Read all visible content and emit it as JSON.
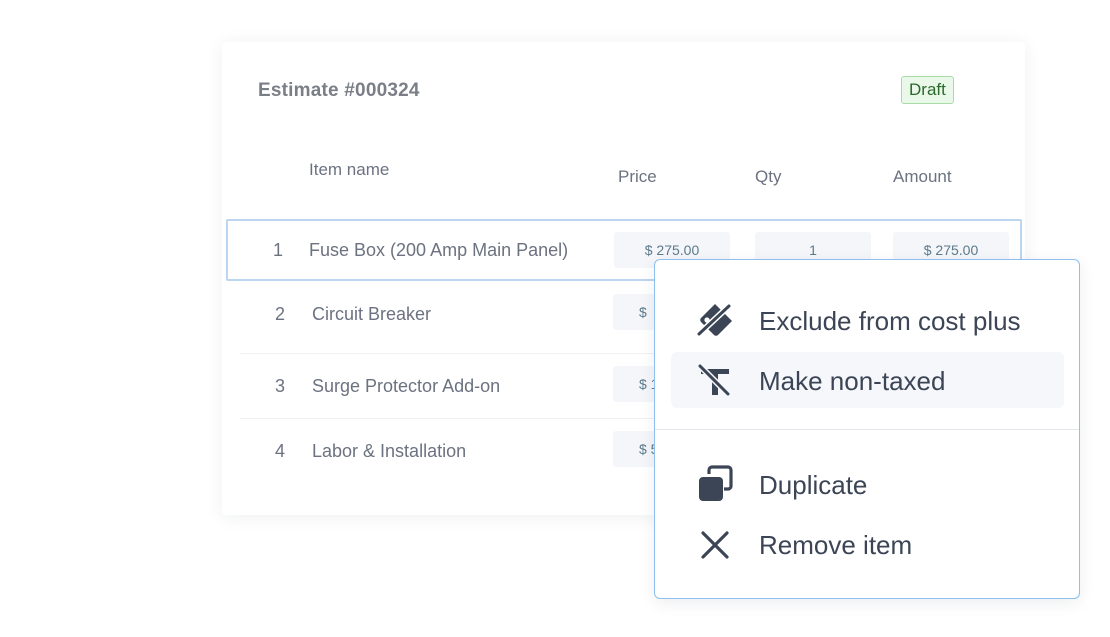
{
  "estimate": {
    "title": "Estimate #000324",
    "status": "Draft"
  },
  "table": {
    "headers": {
      "item_name": "Item name",
      "price": "Price",
      "qty": "Qty",
      "amount": "Amount"
    },
    "rows": [
      {
        "num": "1",
        "name": "Fuse Box (200 Amp Main Panel)",
        "price": "$ 275.00",
        "qty": "1",
        "amount": "$ 275.00"
      },
      {
        "num": "2",
        "name": "Circuit Breaker",
        "price": "$"
      },
      {
        "num": "3",
        "name": "Surge Protector Add-on",
        "price": "$ 1"
      },
      {
        "num": "4",
        "name": "Labor & Installation",
        "price": "$ 5"
      }
    ]
  },
  "context_menu": {
    "items": [
      {
        "label": "Exclude from cost plus",
        "icon": "tag-off-icon"
      },
      {
        "label": "Make non-taxed",
        "icon": "tax-off-icon"
      },
      {
        "label": "Duplicate",
        "icon": "duplicate-icon"
      },
      {
        "label": "Remove item",
        "icon": "close-icon"
      }
    ]
  },
  "colors": {
    "accent_border": "#8cc0ee",
    "selected_row_border": "#bcd5f1",
    "badge_bg": "#eaf8ea",
    "badge_text": "#2a6a2c",
    "icon": "#3c4556"
  }
}
